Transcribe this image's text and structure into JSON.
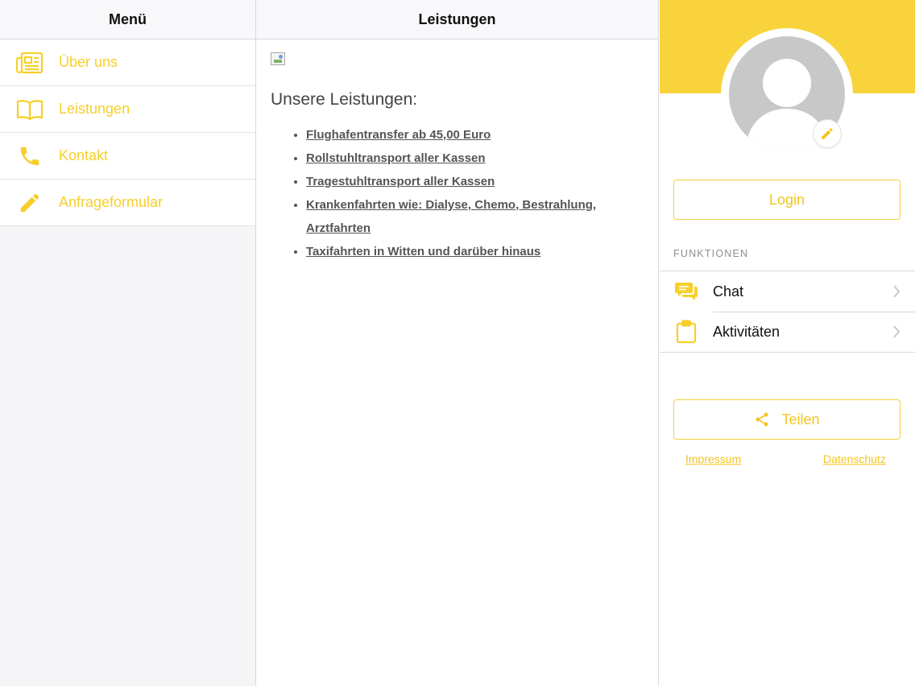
{
  "colors": {
    "accent": "#f9d33b",
    "accent_text": "#f2c521",
    "menu_bg": "#f5f5f7",
    "avatar_gray": "#c8c8c8"
  },
  "menu": {
    "title": "Menü",
    "items": [
      {
        "label": "Über uns",
        "icon": "newspaper-icon"
      },
      {
        "label": "Leistungen",
        "icon": "book-icon"
      },
      {
        "label": "Kontakt",
        "icon": "phone-icon"
      },
      {
        "label": "Anfrageformular",
        "icon": "pencil-icon"
      }
    ]
  },
  "content": {
    "title": "Leistungen",
    "heading": "Unsere Leistungen:",
    "services": [
      "Flughafentransfer ab 45,00 Euro",
      "Rollstuhltransport aller Kassen",
      "Tragestuhltransport aller Kassen",
      "Krankenfahrten wie: Dialyse, Chemo, Bestrahlung, Arztfahrten",
      "Taxifahrten in Witten und darüber hinaus"
    ]
  },
  "side": {
    "login_label": "Login",
    "section_label": "FUNKTIONEN",
    "functions": [
      {
        "label": "Chat",
        "icon": "chat-icon"
      },
      {
        "label": "Aktivitäten",
        "icon": "clipboard-icon"
      }
    ],
    "share_label": "Teilen",
    "footer": {
      "impressum": "Impressum",
      "datenschutz": "Datenschutz"
    }
  }
}
